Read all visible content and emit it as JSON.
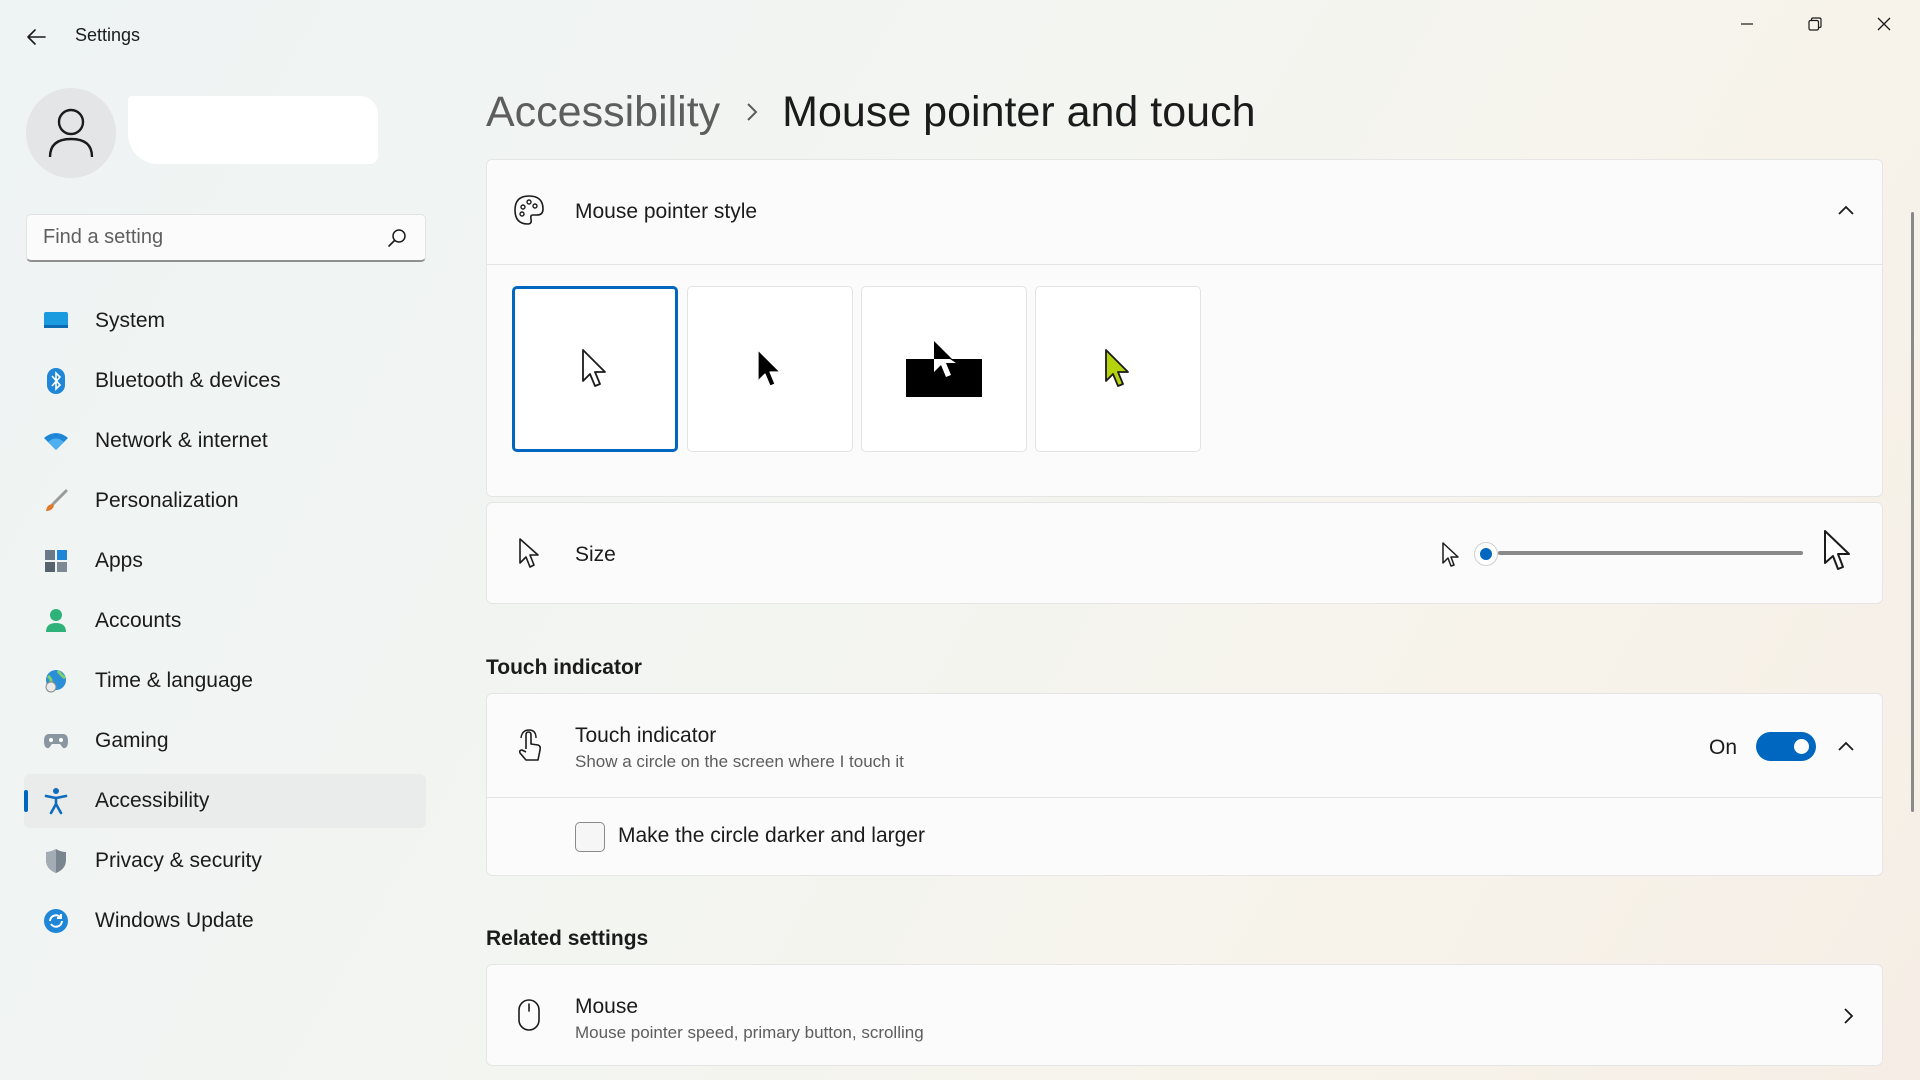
{
  "window": {
    "title": "Settings"
  },
  "search": {
    "placeholder": "Find a setting"
  },
  "sidebar": {
    "items": [
      {
        "label": "System",
        "icon": "system-icon"
      },
      {
        "label": "Bluetooth & devices",
        "icon": "bluetooth-icon"
      },
      {
        "label": "Network & internet",
        "icon": "wifi-icon"
      },
      {
        "label": "Personalization",
        "icon": "brush-icon"
      },
      {
        "label": "Apps",
        "icon": "apps-icon"
      },
      {
        "label": "Accounts",
        "icon": "person-icon"
      },
      {
        "label": "Time & language",
        "icon": "globe-clock-icon"
      },
      {
        "label": "Gaming",
        "icon": "gamepad-icon"
      },
      {
        "label": "Accessibility",
        "icon": "accessibility-icon",
        "active": true
      },
      {
        "label": "Privacy & security",
        "icon": "shield-icon"
      },
      {
        "label": "Windows Update",
        "icon": "update-icon"
      }
    ]
  },
  "breadcrumb": {
    "parent": "Accessibility",
    "current": "Mouse pointer and touch"
  },
  "pointer_style": {
    "title": "Mouse pointer style",
    "styles": [
      "white",
      "black",
      "inverted",
      "custom"
    ],
    "selected": "white",
    "custom_color": "#b5d20f"
  },
  "size": {
    "title": "Size",
    "value_fraction": 0.0
  },
  "touch_section": {
    "heading": "Touch indicator",
    "title": "Touch indicator",
    "subtitle": "Show a circle on the screen where I touch it",
    "state_label": "On",
    "enabled": true,
    "checkbox_label": "Make the circle darker and larger",
    "checkbox_checked": false
  },
  "related": {
    "heading": "Related settings",
    "mouse_title": "Mouse",
    "mouse_subtitle": "Mouse pointer speed, primary button, scrolling"
  },
  "colors": {
    "accent": "#0067c0",
    "card": "#fbfbfb",
    "text": "#1b1b1b",
    "subtext": "#5d5d5d"
  }
}
